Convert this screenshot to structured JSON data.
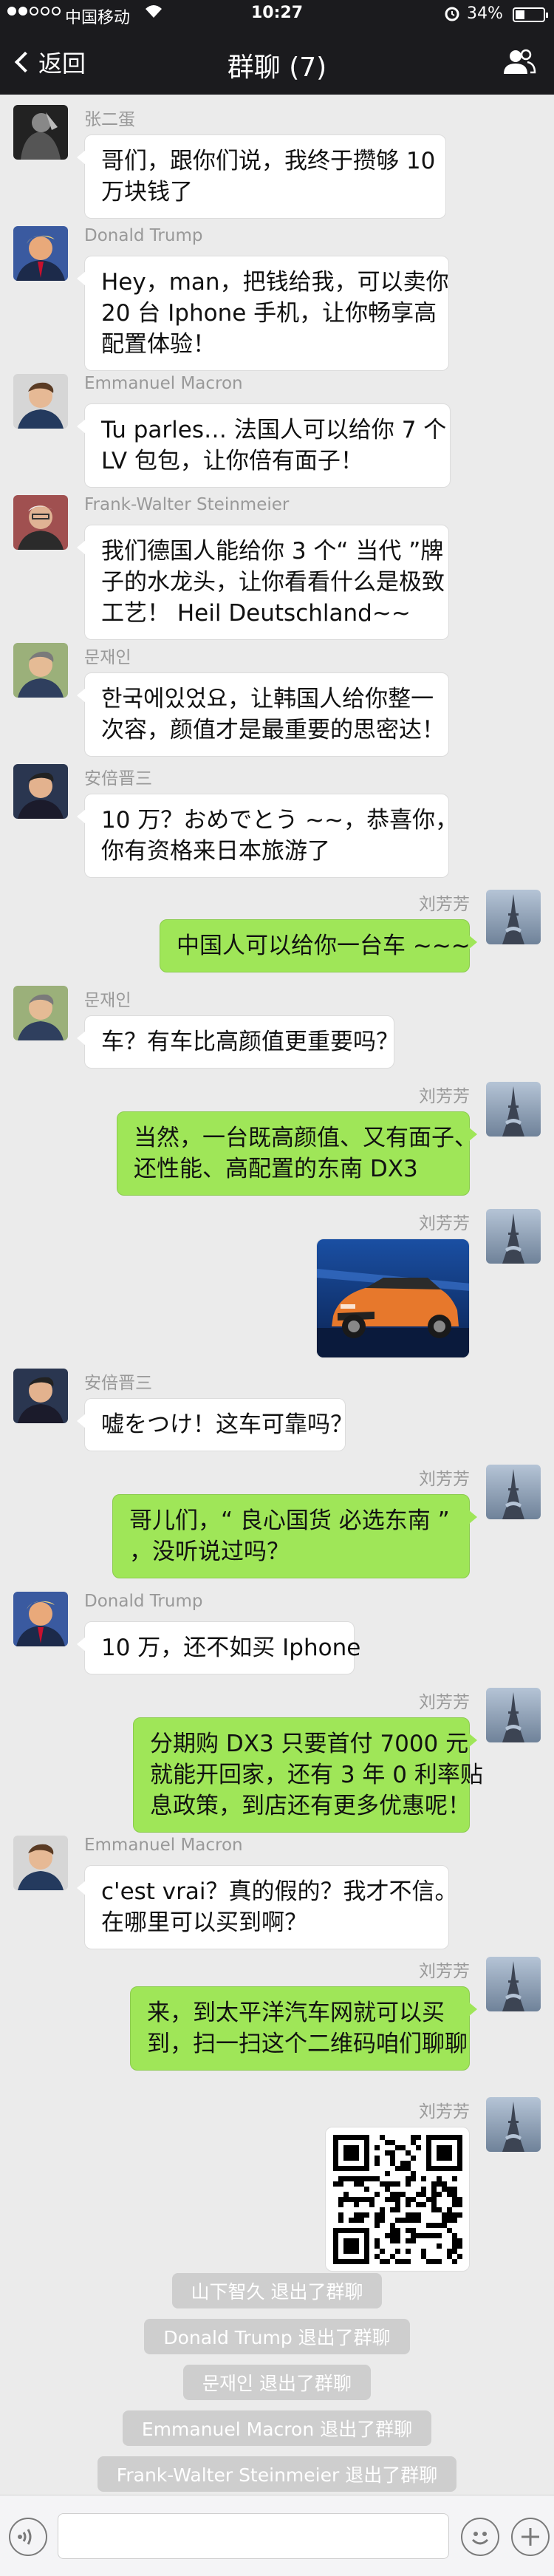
{
  "status_bar": {
    "carrier": "中国移动",
    "time": "10:27",
    "battery": "34%",
    "battery_level": 0.34
  },
  "nav": {
    "back_label": "返回",
    "title": "群聊 (7)"
  },
  "messages": [
    {
      "side": "left",
      "sender": "张二蛋",
      "avatar": "avatar-zhang",
      "text": [
        "哥们，跟你们说，我终于攒够 10",
        "万块钱了"
      ]
    },
    {
      "side": "left",
      "sender": "Donald Trump",
      "avatar": "avatar-trump",
      "text": [
        "Hey，man，把钱给我，可以卖你",
        "20 台 Iphone 手机，让你畅享高",
        "配置体验！"
      ]
    },
    {
      "side": "left",
      "sender": "Emmanuel Macron",
      "avatar": "avatar-macron",
      "text": [
        "Tu parles… 法国人可以给你 7 个",
        "LV 包包，让你倍有面子！"
      ]
    },
    {
      "side": "left",
      "sender": "Frank-Walter Steinmeier",
      "avatar": "avatar-steinmeier",
      "text": [
        "我们德国人能给你 3 个“ 当代 ”牌",
        "子的水龙头，让你看看什么是极致",
        "工艺！ Heil Deutschland~~"
      ]
    },
    {
      "side": "left",
      "sender": "문재인",
      "avatar": "avatar-moon",
      "text": [
        "한국에있었요，让韩国人给你整一",
        "次容，颜值才是最重要的思密达！"
      ]
    },
    {
      "side": "left",
      "sender": "安倍晋三",
      "avatar": "avatar-abe",
      "text": [
        "10 万？おめでとう ~~，恭喜你，",
        "你有资格来日本旅游了"
      ]
    },
    {
      "side": "right",
      "sender": "刘芳芳",
      "avatar": "avatar-liu",
      "text": [
        "中国人可以给你一台车 ~~~"
      ]
    },
    {
      "side": "left",
      "sender": "문재인",
      "avatar": "avatar-moon",
      "text": [
        "车？有车比高颜值更重要吗？"
      ]
    },
    {
      "side": "right",
      "sender": "刘芳芳",
      "avatar": "avatar-liu",
      "text": [
        "当然，一台既高颜值、又有面子、",
        "还性能、高配置的东南 DX3"
      ]
    },
    {
      "side": "right",
      "sender": "刘芳芳",
      "avatar": "avatar-liu",
      "image": "car-photo"
    },
    {
      "side": "left",
      "sender": "安倍晋三",
      "avatar": "avatar-abe",
      "text": [
        "嘘をつけ！这车可靠吗？"
      ]
    },
    {
      "side": "right",
      "sender": "刘芳芳",
      "avatar": "avatar-liu",
      "text": [
        "哥儿们，“ 良心国货 必选东南 ”",
        "，没听说过吗？"
      ]
    },
    {
      "side": "left",
      "sender": "Donald Trump",
      "avatar": "avatar-trump",
      "text": [
        "10 万，还不如买 Iphone"
      ]
    },
    {
      "side": "right",
      "sender": "刘芳芳",
      "avatar": "avatar-liu",
      "text": [
        "分期购 DX3 只要首付 7000 元",
        "就能开回家，还有 3 年 0 利率贴",
        "息政策，到店还有更多优惠呢！"
      ]
    },
    {
      "side": "left",
      "sender": "Emmanuel Macron",
      "avatar": "avatar-macron",
      "text": [
        "c'est vrai？真的假的？我才不信。",
        "在哪里可以买到啊？"
      ]
    },
    {
      "side": "right",
      "sender": "刘芳芳",
      "avatar": "avatar-liu",
      "text": [
        "来，到太平洋汽车网就可以买",
        "到，扫一扫这个二维码咱们聊聊"
      ]
    },
    {
      "side": "right",
      "sender": "刘芳芳",
      "avatar": "avatar-liu",
      "image": "qr-code"
    }
  ],
  "system_notices": [
    "山下智久 退出了群聊",
    "Donald Trump 退出了群聊",
    "문재인 退出了群聊",
    "Emmanuel Macron  退出了群聊",
    "Frank-Walter Steinmeier 退出了群聊"
  ],
  "colors": {
    "bar": "#1b1b1e",
    "background": "#ebebeb",
    "bubble_left": "#ffffff",
    "bubble_right": "#9fe658",
    "name": "#999999"
  },
  "icons": {
    "back": "chevron-left-icon",
    "group": "group-members-icon",
    "voice": "voice-icon",
    "emoji": "emoji-icon",
    "plus": "plus-icon"
  }
}
